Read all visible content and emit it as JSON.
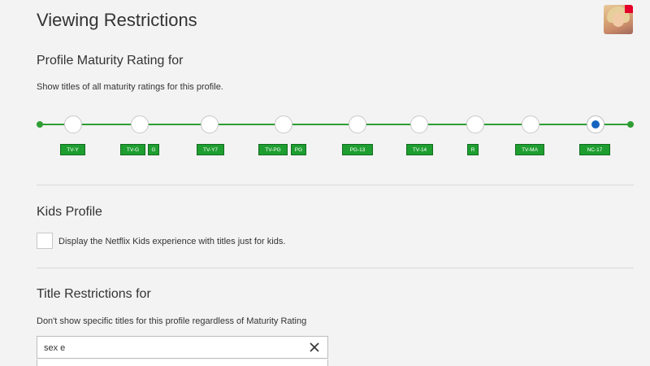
{
  "header": {
    "title": "Viewing Restrictions"
  },
  "maturity": {
    "heading": "Profile Maturity Rating for",
    "description": "Show titles of all maturity ratings for this profile.",
    "levels": [
      {
        "badges": [
          "TV-Y"
        ]
      },
      {
        "badges": [
          "TV-G",
          "G"
        ]
      },
      {
        "badges": [
          "TV-Y7"
        ]
      },
      {
        "badges": [
          "TV-PG",
          "PG"
        ]
      },
      {
        "badges": [
          "PG-13"
        ]
      },
      {
        "badges": [
          "TV-14"
        ]
      },
      {
        "badges": [
          "R"
        ]
      },
      {
        "badges": [
          "TV-MA"
        ]
      },
      {
        "badges": [
          "NC-17"
        ]
      }
    ],
    "selected_index": 8,
    "colors": {
      "track": "#2e9e34",
      "badge": "#1e9e30",
      "selected_dot": "#1565c0"
    }
  },
  "kids": {
    "heading": "Kids Profile",
    "checkbox_label": "Display the Netflix Kids experience with titles just for kids.",
    "checked": false
  },
  "title_restrictions": {
    "heading": "Title Restrictions for",
    "description": "Don't show specific titles for this profile regardless of Maturity Rating",
    "search_value": "sex e"
  },
  "icons": {
    "clear": "close-icon",
    "avatar": "profile-avatar"
  }
}
